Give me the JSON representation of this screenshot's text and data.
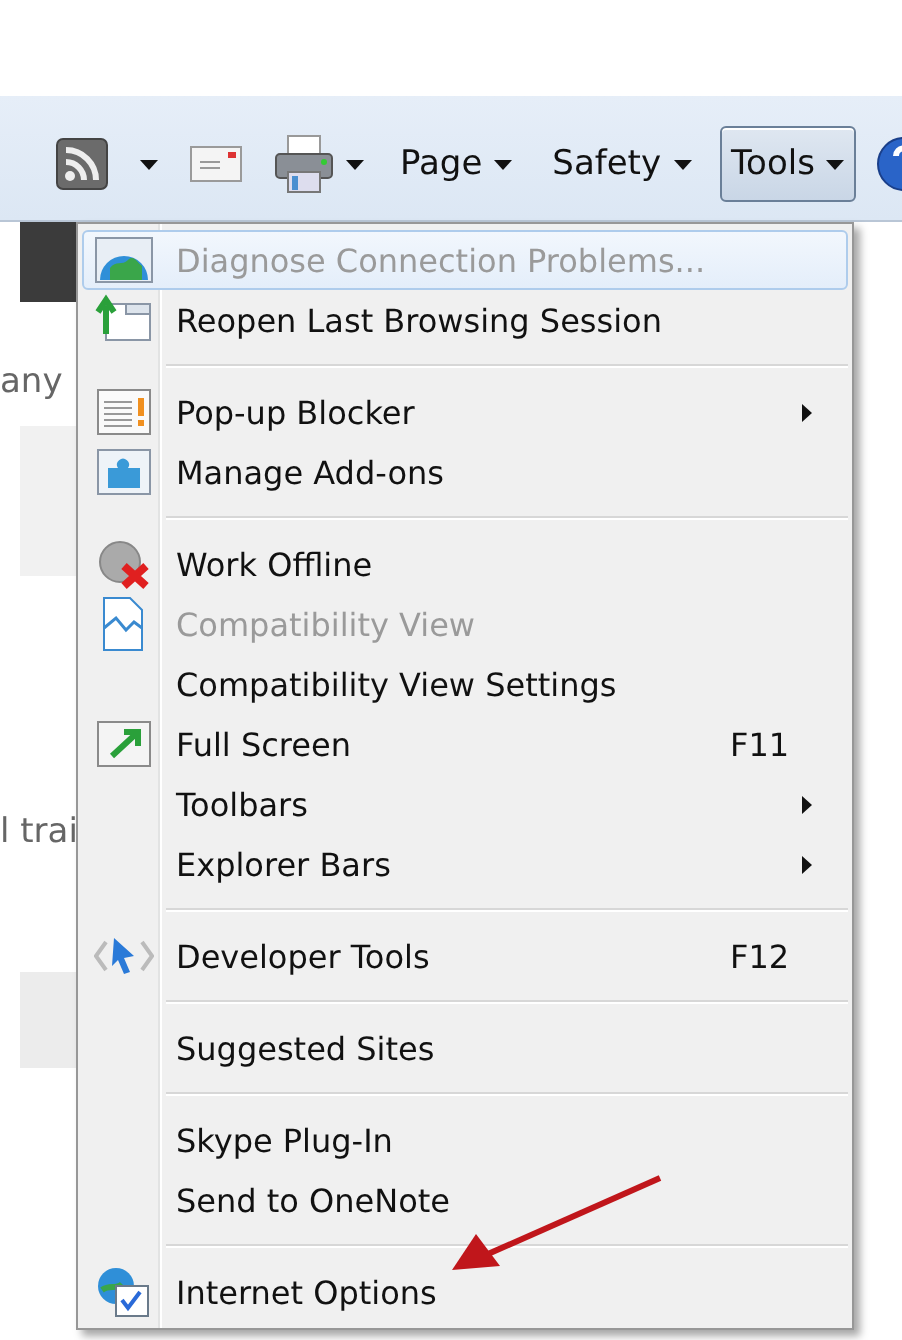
{
  "toolbar": {
    "buttons": [
      {
        "kind": "feed",
        "selected": false
      },
      {
        "kind": "mail",
        "selected": false
      },
      {
        "kind": "print",
        "selected": false
      },
      {
        "kind": "menu",
        "label": "Page",
        "selected": false
      },
      {
        "kind": "menu",
        "label": "Safety",
        "selected": false
      },
      {
        "kind": "menu",
        "label": "Tools",
        "selected": true
      },
      {
        "kind": "help",
        "selected": false
      }
    ]
  },
  "page": {
    "texts": [
      "any",
      "l trai"
    ]
  },
  "menu": {
    "items": [
      {
        "kind": "item",
        "label": "Diagnose Connection Problems...",
        "disabled": true,
        "selected": true
      },
      {
        "kind": "item",
        "label": "Reopen Last Browsing Session",
        "disabled": false,
        "selected": false
      },
      {
        "kind": "separator"
      },
      {
        "kind": "item",
        "label": "Pop-up Blocker",
        "disabled": false,
        "selected": false,
        "submenu": true
      },
      {
        "kind": "item",
        "label": "Manage Add-ons",
        "disabled": false,
        "selected": false
      },
      {
        "kind": "separator"
      },
      {
        "kind": "item",
        "label": "Work Offline",
        "disabled": false,
        "selected": false
      },
      {
        "kind": "item",
        "label": "Compatibility View",
        "disabled": true,
        "selected": false
      },
      {
        "kind": "item",
        "label": "Compatibility View Settings",
        "disabled": false,
        "selected": false
      },
      {
        "kind": "item",
        "label": "Full Screen",
        "disabled": false,
        "selected": false,
        "shortcut": "F11"
      },
      {
        "kind": "item",
        "label": "Toolbars",
        "disabled": false,
        "selected": false,
        "submenu": true
      },
      {
        "kind": "item",
        "label": "Explorer Bars",
        "disabled": false,
        "selected": false,
        "submenu": true
      },
      {
        "kind": "separator"
      },
      {
        "kind": "item",
        "label": "Developer Tools",
        "disabled": false,
        "selected": false,
        "shortcut": "F12"
      },
      {
        "kind": "separator"
      },
      {
        "kind": "item",
        "label": "Suggested Sites",
        "disabled": false,
        "selected": false
      },
      {
        "kind": "separator"
      },
      {
        "kind": "item",
        "label": "Skype Plug-In",
        "disabled": false,
        "selected": false
      },
      {
        "kind": "item",
        "label": "Send to OneNote",
        "disabled": false,
        "selected": false
      },
      {
        "kind": "separator"
      },
      {
        "kind": "item",
        "label": "Internet Options",
        "disabled": false,
        "selected": false
      }
    ]
  }
}
